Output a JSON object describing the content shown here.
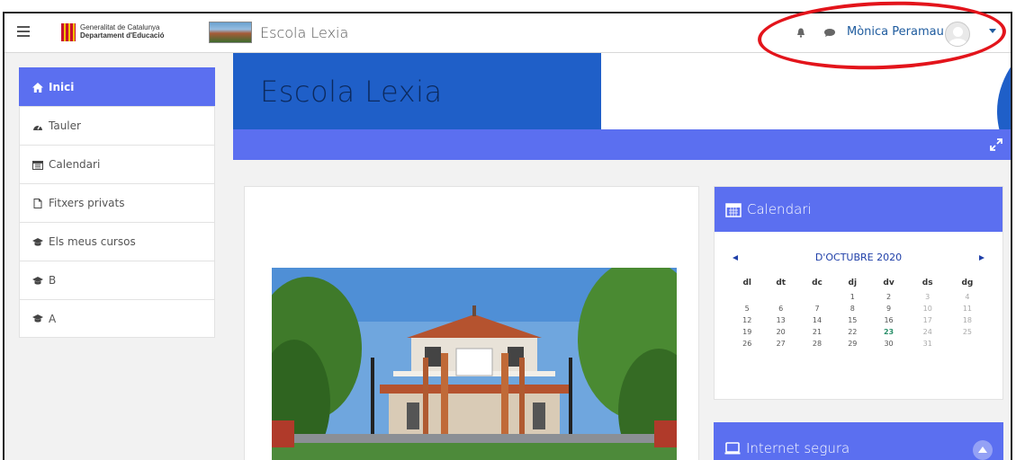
{
  "navbar": {
    "gencat_line1": "Generalitat de Catalunya",
    "gencat_line2": "Departament d'Educació",
    "site_name": "Escola Lexia",
    "user_name": "Mònica Peramau"
  },
  "sidebar": {
    "items": [
      {
        "label": "Inici",
        "icon": "home-icon",
        "active": true
      },
      {
        "label": "Tauler",
        "icon": "dashboard-icon"
      },
      {
        "label": "Calendari",
        "icon": "calendar-icon"
      },
      {
        "label": "Fitxers privats",
        "icon": "file-icon"
      },
      {
        "label": "Els meus cursos",
        "icon": "graduation-cap-icon"
      },
      {
        "label": "B",
        "icon": "graduation-cap-icon"
      },
      {
        "label": "A",
        "icon": "graduation-cap-icon"
      }
    ]
  },
  "banner": {
    "title": "Escola Lexia"
  },
  "calendar": {
    "title": "Calendari",
    "month": "D'OCTUBRE 2020",
    "weekdays": [
      "dl",
      "dt",
      "dc",
      "dj",
      "dv",
      "ds",
      "dg"
    ],
    "weeks": [
      [
        "",
        "",
        "",
        "1",
        "2",
        "3",
        "4"
      ],
      [
        "5",
        "6",
        "7",
        "8",
        "9",
        "10",
        "11"
      ],
      [
        "12",
        "13",
        "14",
        "15",
        "16",
        "17",
        "18"
      ],
      [
        "19",
        "20",
        "21",
        "22",
        "23",
        "24",
        "25"
      ],
      [
        "26",
        "27",
        "28",
        "29",
        "30",
        "31",
        ""
      ]
    ],
    "today": "23"
  },
  "internet_block": {
    "title": "Internet segura"
  },
  "colors": {
    "accent": "#5b6ff0",
    "banner_blue": "#1f5fc8",
    "annotation_red": "#e3141b"
  }
}
